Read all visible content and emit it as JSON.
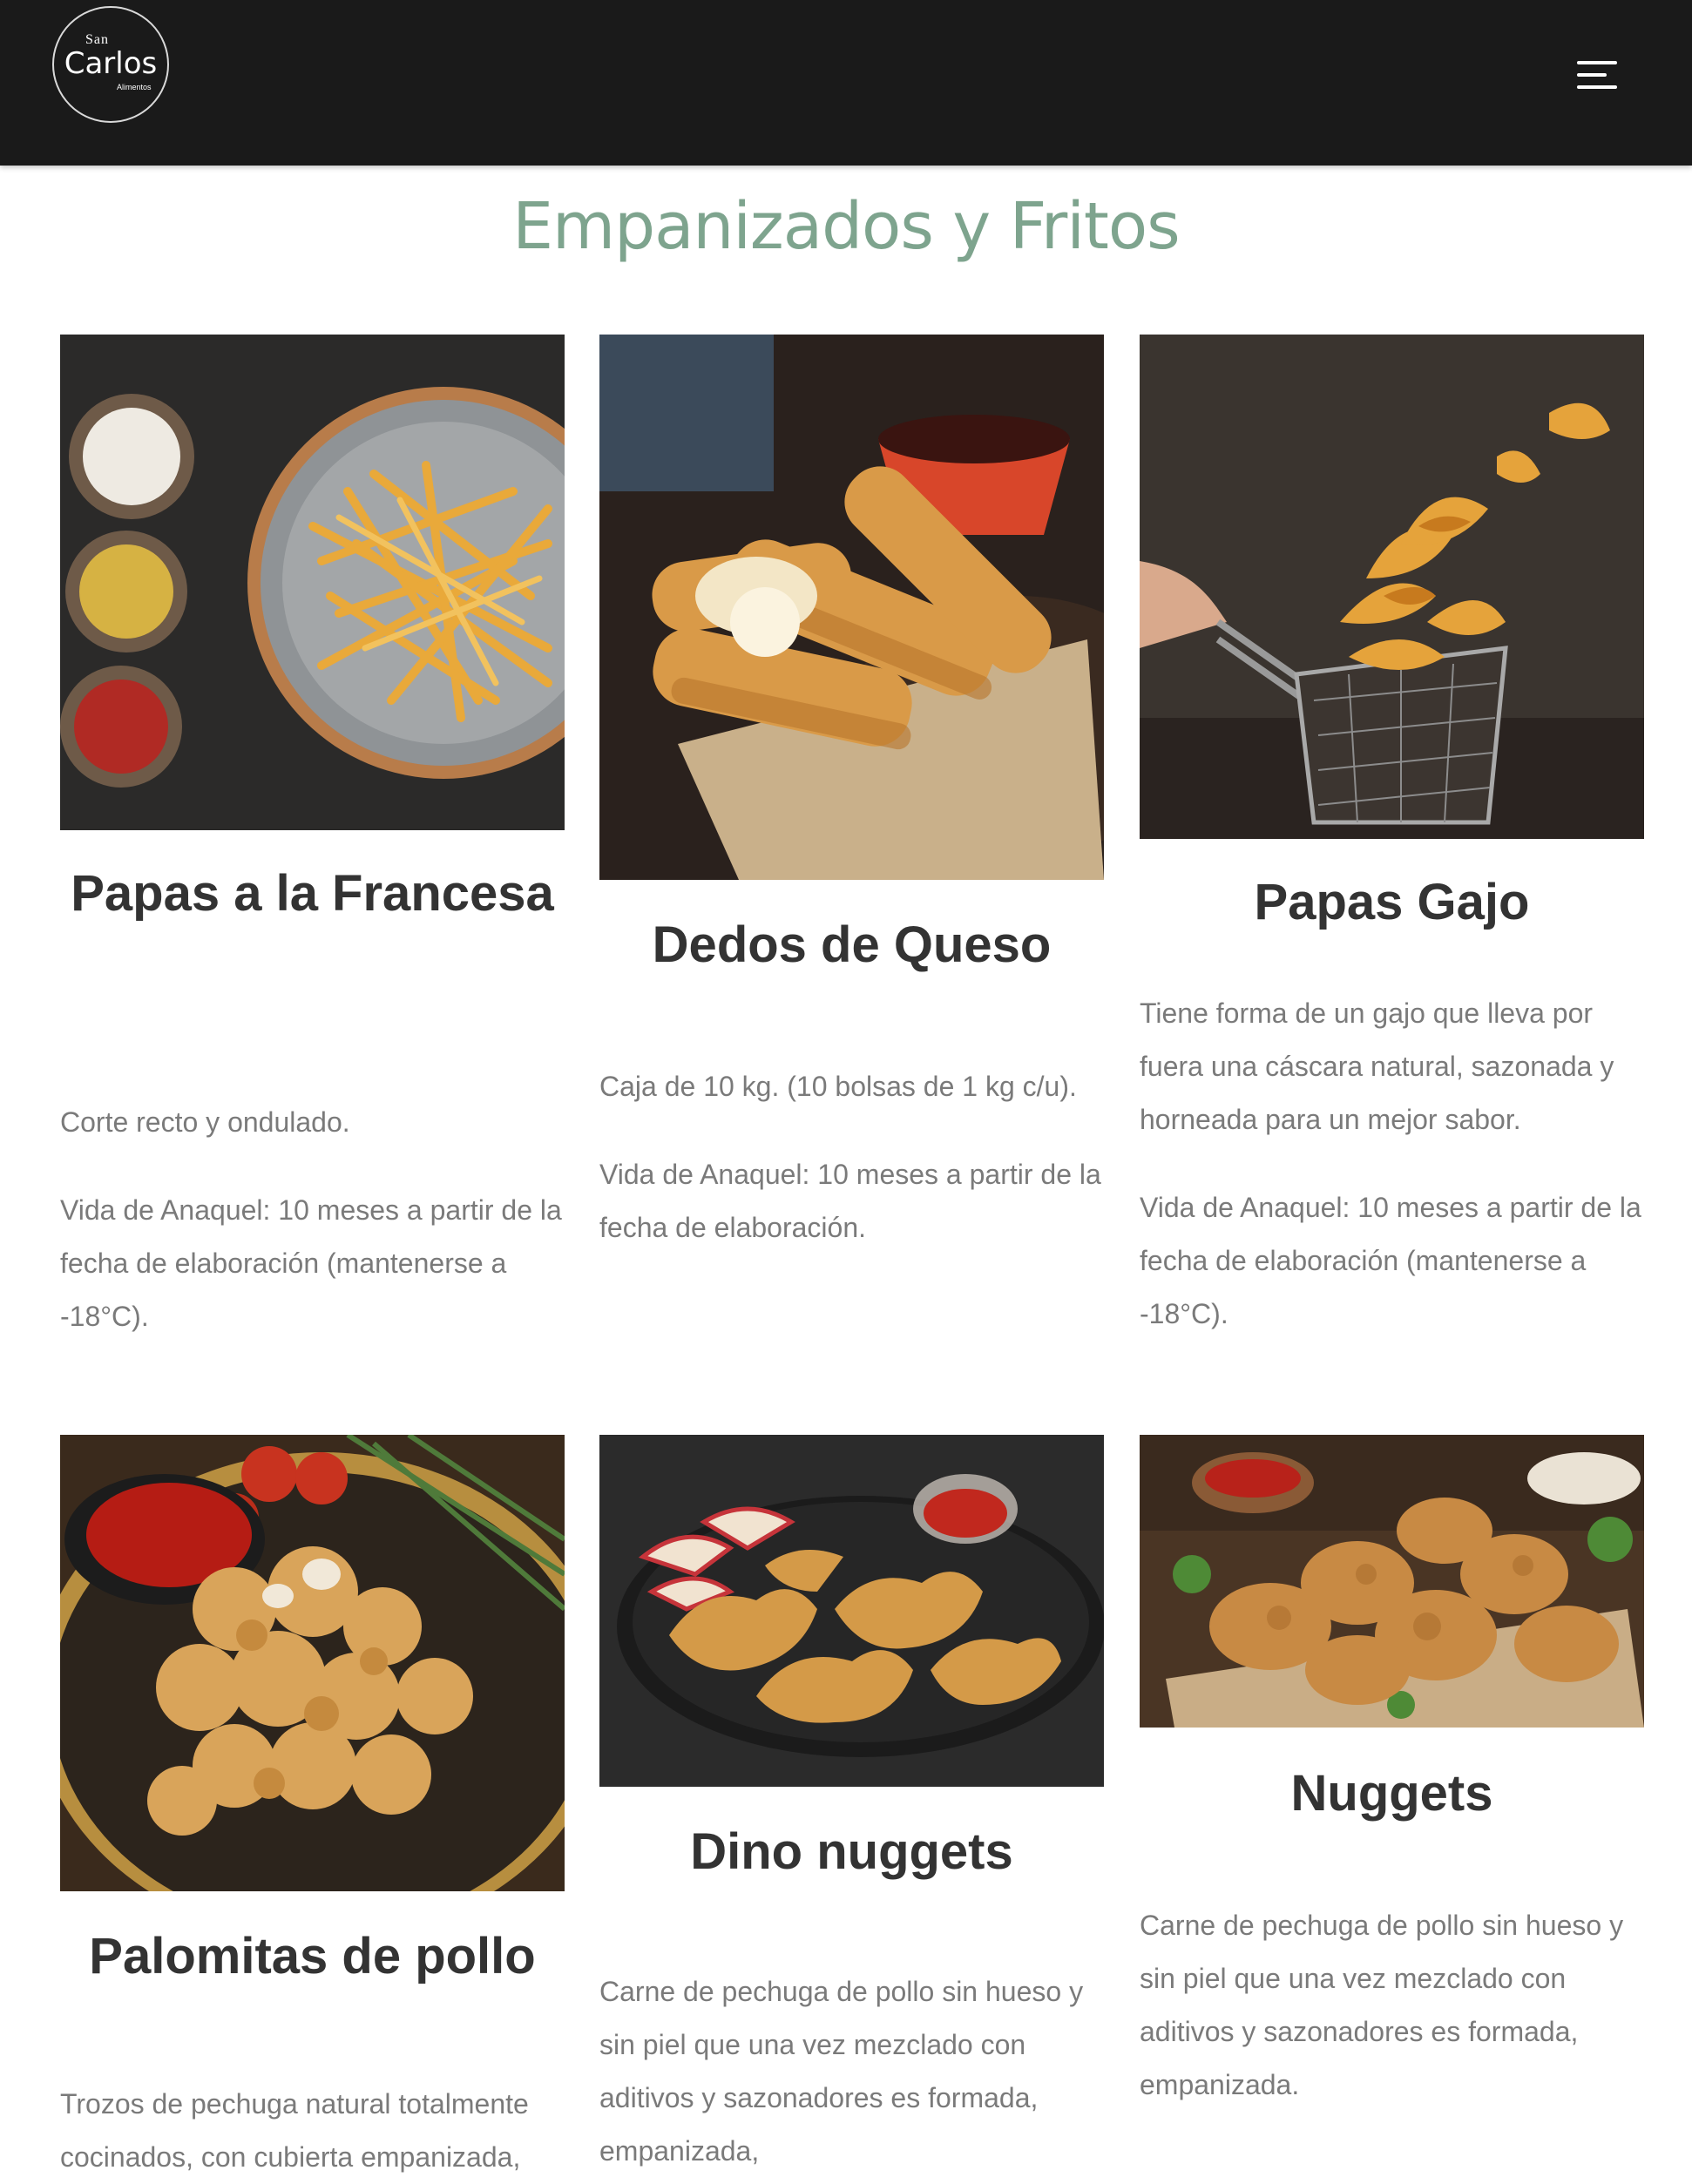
{
  "header": {
    "logo": {
      "line1": "San",
      "line2": "Carlos",
      "line3": "Alimentos"
    },
    "menu_icon": "hamburger-menu-icon"
  },
  "section": {
    "title": "Empanizados y Fritos"
  },
  "products": [
    {
      "name": "Papas a la Francesa",
      "image": "french-fries-plate-image",
      "texts": [
        "Corte recto y ondulado.",
        "Vida de Anaquel: 10 meses a partir de la fecha de elaboración (mantenerse a -18°C)."
      ]
    },
    {
      "name": "Dedos de Queso",
      "image": "cheese-sticks-image",
      "texts": [
        "Caja de 10 kg. (10 bolsas de 1 kg c/u).",
        "Vida de Anaquel: 10 meses a partir de la fecha de elaboración."
      ]
    },
    {
      "name": "Papas Gajo",
      "image": "potato-wedges-basket-image",
      "texts": [
        "Tiene forma de un gajo que lleva por fuera una cáscara natural, sazonada y horneada para un mejor sabor.",
        "Vida de Anaquel: 10 meses a partir de la fecha de elaboración (mantenerse a -18°C)."
      ]
    },
    {
      "name": "Palomitas de pollo",
      "image": "popcorn-chicken-image",
      "texts": [
        "Trozos de pechuga natural totalmente cocinados, con cubierta empanizada,"
      ]
    },
    {
      "name": "Dino nuggets",
      "image": "dino-nuggets-image",
      "texts": [
        "Carne de pechuga de pollo sin hueso y sin piel que una vez mezclado con aditivos y sazonadores es formada, empanizada,"
      ]
    },
    {
      "name": "Nuggets",
      "image": "chicken-nuggets-image",
      "texts": [
        "Carne de pechuga de pollo sin hueso y sin piel que una vez mezclado con aditivos y sazonadores es formada, empanizada."
      ]
    }
  ]
}
